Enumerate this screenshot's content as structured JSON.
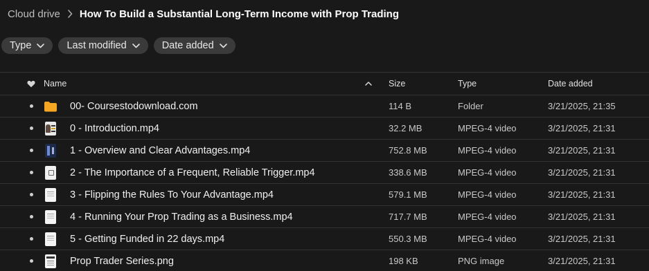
{
  "breadcrumb": {
    "root": "Cloud drive",
    "separator_icon": "chevron-right-icon",
    "current": "How To Build a Substantial Long-Term Income with Prop Trading"
  },
  "filters": [
    {
      "label": "Type",
      "icon": "chevron-down-icon"
    },
    {
      "label": "Last modified",
      "icon": "chevron-down-icon"
    },
    {
      "label": "Date added",
      "icon": "chevron-down-icon"
    }
  ],
  "table": {
    "header": {
      "fav_icon": "heart-icon",
      "name": "Name",
      "sort_icon": "chevron-up-icon",
      "size": "Size",
      "type": "Type",
      "date": "Date added"
    },
    "rows": [
      {
        "name": "00- Coursestodownload.com",
        "size": "114 B",
        "type": "Folder",
        "date": "3/21/2025, 21:35",
        "icon": "folder-icon"
      },
      {
        "name": "0 - Introduction.mp4",
        "size": "32.2 MB",
        "type": "MPEG-4 video",
        "date": "3/21/2025, 21:31",
        "icon": "video-thumbnail-icon"
      },
      {
        "name": "1 - Overview and Clear Advantages.mp4",
        "size": "752.8 MB",
        "type": "MPEG-4 video",
        "date": "3/21/2025, 21:31",
        "icon": "video-thumbnail-icon"
      },
      {
        "name": "2 - The Importance of a Frequent, Reliable Trigger.mp4",
        "size": "338.6 MB",
        "type": "MPEG-4 video",
        "date": "3/21/2025, 21:31",
        "icon": "video-thumbnail-icon"
      },
      {
        "name": "3 - Flipping the Rules To Your Advantage.mp4",
        "size": "579.1 MB",
        "type": "MPEG-4 video",
        "date": "3/21/2025, 21:31",
        "icon": "video-thumbnail-icon"
      },
      {
        "name": "4 - Running Your Prop Trading as a Business.mp4",
        "size": "717.7 MB",
        "type": "MPEG-4 video",
        "date": "3/21/2025, 21:31",
        "icon": "video-thumbnail-icon"
      },
      {
        "name": "5 - Getting Funded in 22 days.mp4",
        "size": "550.3 MB",
        "type": "MPEG-4 video",
        "date": "3/21/2025, 21:31",
        "icon": "video-thumbnail-icon"
      },
      {
        "name": "Prop Trader Series.png",
        "size": "198 KB",
        "type": "PNG image",
        "date": "3/21/2025, 21:31",
        "icon": "image-thumbnail-icon"
      }
    ]
  },
  "colors": {
    "background": "#191919",
    "chip_background": "#3a3a3a",
    "folder": "#f5a623",
    "divider": "#343434"
  }
}
